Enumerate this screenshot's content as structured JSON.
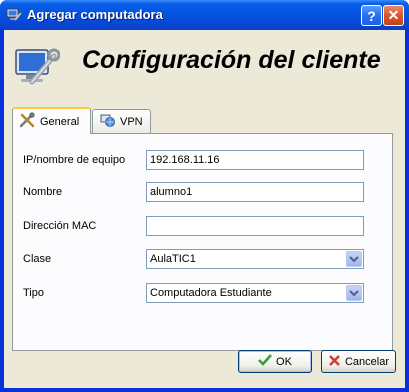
{
  "window": {
    "title": "Agregar computadora",
    "help_label": "?",
    "close_label": "✕"
  },
  "header": {
    "title": "Configuración del cliente"
  },
  "tabs": [
    {
      "label": "General",
      "active": true
    },
    {
      "label": "VPN",
      "active": false
    }
  ],
  "form": {
    "ip_label": "IP/nombre de equipo",
    "ip_value": "192.168.11.16",
    "name_label": "Nombre",
    "name_value": "alumno1",
    "mac_label": "Dirección MAC",
    "mac_value": "",
    "class_label": "Clase",
    "class_value": "AulaTIC1",
    "type_label": "Tipo",
    "type_value": "Computadora Estudiante"
  },
  "buttons": {
    "ok_label": "OK",
    "cancel_label": "Cancelar"
  },
  "colors": {
    "titlebar": "#0553e0",
    "dialog_bg": "#ece9d8",
    "tab_highlight": "#ffc83c",
    "ok_check": "#3a9a3a",
    "cancel_x": "#d93a2a"
  },
  "icons": {
    "title": "computer-tools-icon",
    "header": "computer-wrench-icon",
    "tab_general": "tools-icon",
    "tab_vpn": "globe-network-icon",
    "dropdown": "chevron-down-icon",
    "ok": "checkmark-icon",
    "cancel": "cross-icon"
  }
}
